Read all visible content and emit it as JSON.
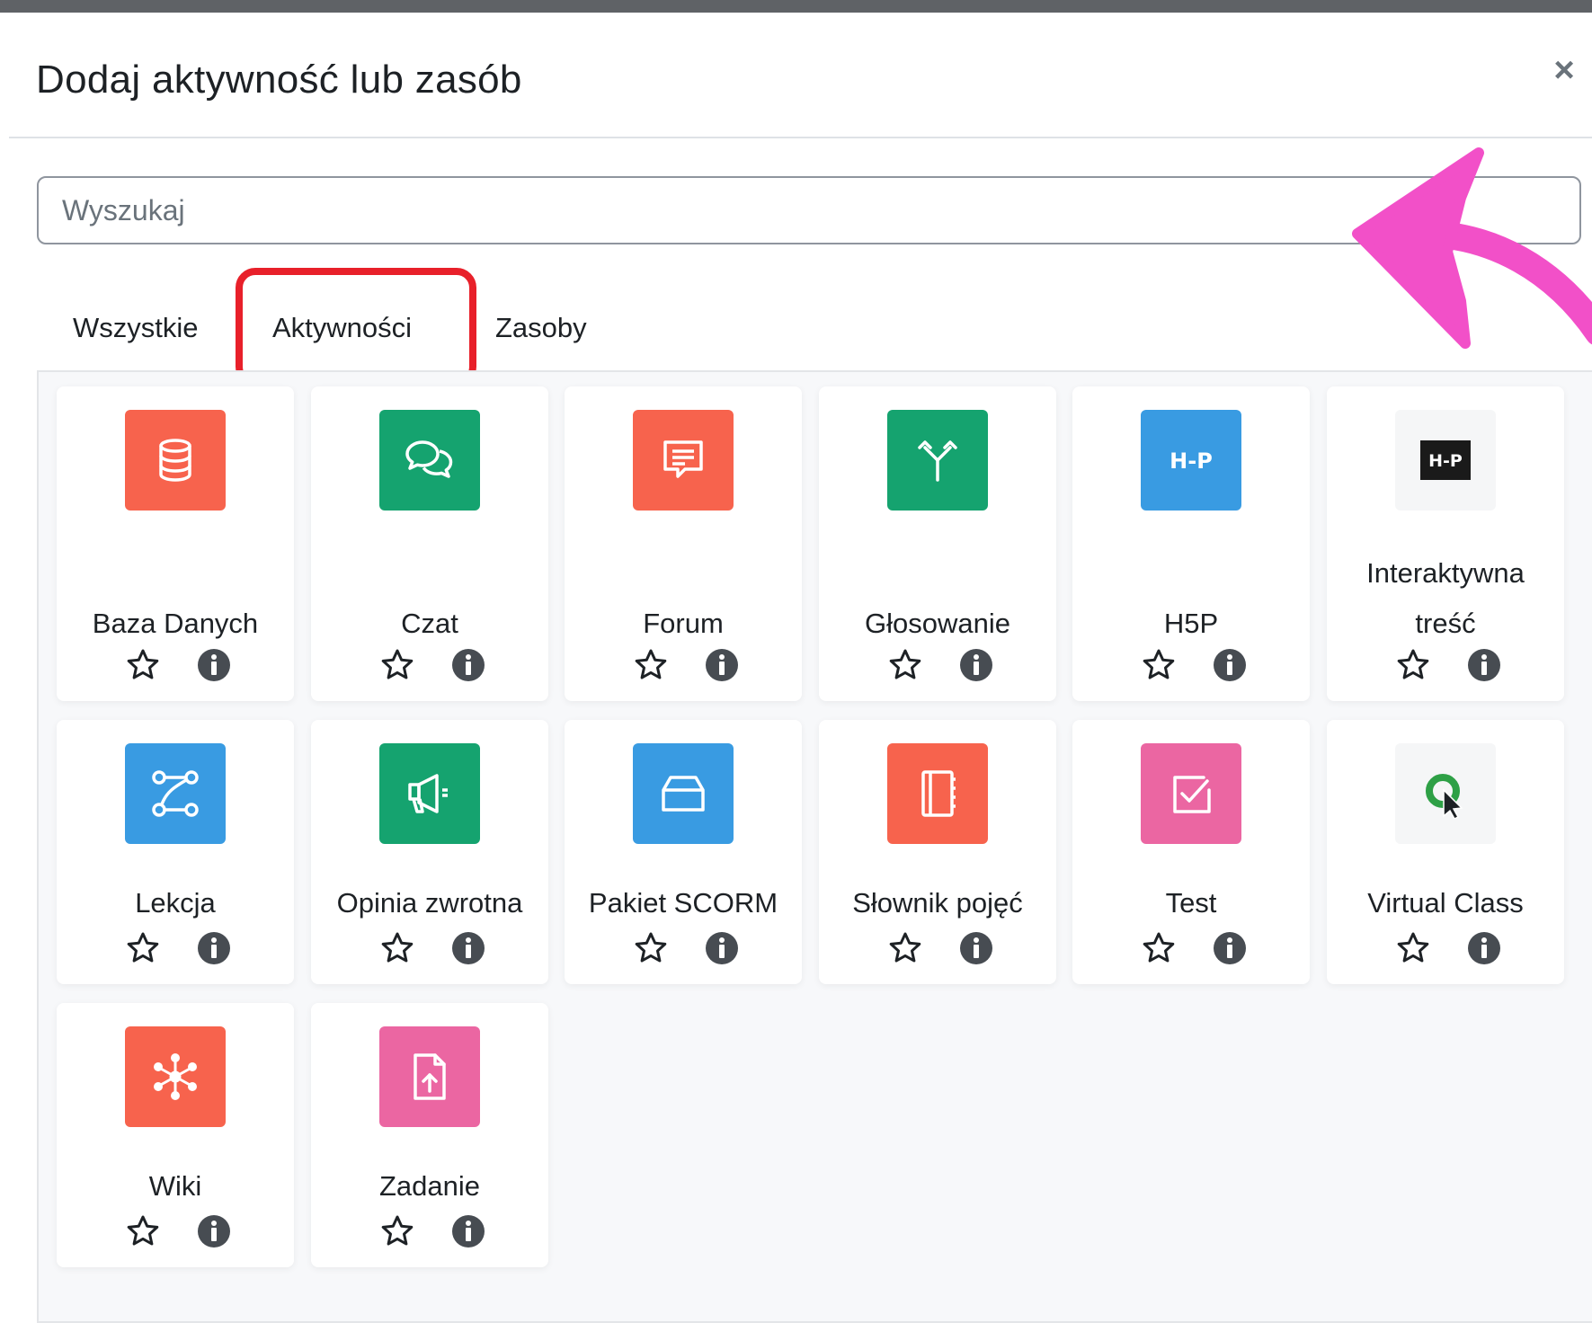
{
  "modal": {
    "title": "Dodaj aktywność lub zasób",
    "close_symbol": "×"
  },
  "search": {
    "placeholder": "Wyszukaj"
  },
  "tabs": [
    {
      "label": "Wszystkie"
    },
    {
      "label": "Aktywności",
      "selected": true
    },
    {
      "label": "Zasoby"
    }
  ],
  "activities": [
    {
      "name": "Baza Danych",
      "icon": "database-icon",
      "color": "#f7634d"
    },
    {
      "name": "Czat",
      "icon": "chat-icon",
      "color": "#15a36f"
    },
    {
      "name": "Forum",
      "icon": "forum-icon",
      "color": "#f7634d"
    },
    {
      "name": "Głosowanie",
      "icon": "choice-icon",
      "color": "#15a36f"
    },
    {
      "name": "H5P",
      "icon": "h5p-icon",
      "color": "#399be2"
    },
    {
      "name": "Interaktywna treść",
      "name_line1": "Interaktywna",
      "name_line2": "treść",
      "icon": "h5p-interactive-icon",
      "color": "#f5f6f7"
    },
    {
      "name": "Lekcja",
      "icon": "lesson-icon",
      "color": "#399be2"
    },
    {
      "name": "Opinia zwrotna",
      "icon": "feedback-icon",
      "color": "#15a36f"
    },
    {
      "name": "Pakiet SCORM",
      "icon": "scorm-package-icon",
      "color": "#399be2"
    },
    {
      "name": "Słownik pojęć",
      "icon": "glossary-icon",
      "color": "#f7634d"
    },
    {
      "name": "Test",
      "icon": "quiz-icon",
      "color": "#eb66a2"
    },
    {
      "name": "Virtual Class",
      "icon": "virtual-class-icon",
      "color": "#f5f6f7"
    },
    {
      "name": "Wiki",
      "icon": "wiki-icon",
      "color": "#f7634d"
    },
    {
      "name": "Zadanie",
      "icon": "assignment-icon",
      "color": "#eb66a2"
    }
  ],
  "colors": {
    "tab_highlight": "#e8202a",
    "arrow_annotation": "#f250c8"
  }
}
